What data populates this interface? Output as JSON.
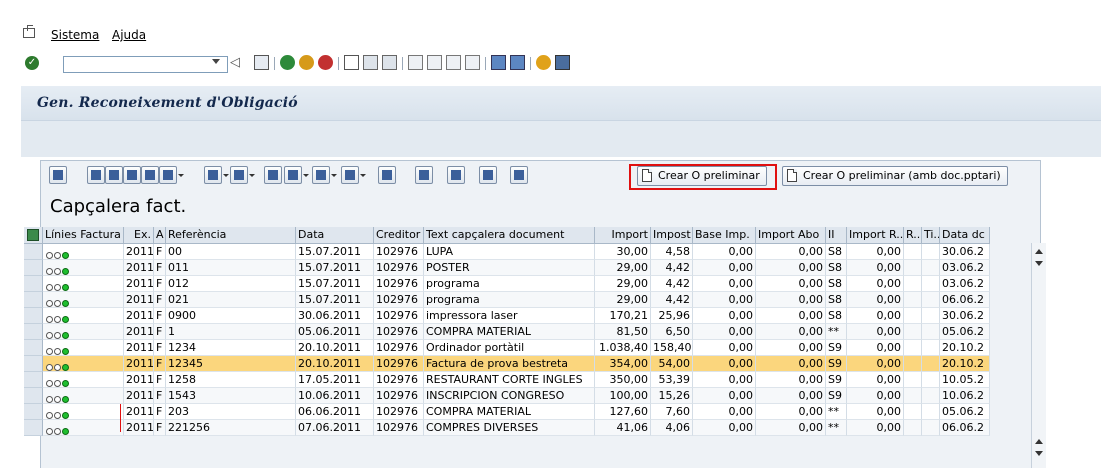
{
  "menu": {
    "items": [
      "Sistema",
      "Ajuda"
    ]
  },
  "toolbar": {
    "command_value": ""
  },
  "title": "Gen. Reconeixement d'Obligació",
  "alv": {
    "button_create": "Crear O preliminar",
    "button_create_pptari": "Crear O preliminar (amb doc.pptari)",
    "grid_title": "Capçalera fact."
  },
  "columns": [
    "Línies Factura",
    "Ex.",
    "A",
    "Referència",
    "Data",
    "Creditor",
    "Text capçalera document",
    "Import",
    "Impost",
    "Base Imp.",
    "Import Abo",
    "II",
    "Import R...",
    "R..",
    "Ti..",
    "Data dc"
  ],
  "rows": [
    {
      "ex": "2011",
      "a": "F",
      "ref": "00",
      "data": "15.07.2011",
      "cred": "102976",
      "text": "LUPA",
      "imp": "30,00",
      "impost": "4,58",
      "base": "0,00",
      "abo": "0,00",
      "ii": "S8",
      "impr": "0,00",
      "r": "",
      "ti": "",
      "datadc": "30.06.2"
    },
    {
      "ex": "2011",
      "a": "F",
      "ref": "011",
      "data": "15.07.2011",
      "cred": "102976",
      "text": "POSTER",
      "imp": "29,00",
      "impost": "4,42",
      "base": "0,00",
      "abo": "0,00",
      "ii": "S8",
      "impr": "0,00",
      "r": "",
      "ti": "",
      "datadc": "03.06.2"
    },
    {
      "ex": "2011",
      "a": "F",
      "ref": "012",
      "data": "15.07.2011",
      "cred": "102976",
      "text": "programa",
      "imp": "29,00",
      "impost": "4,42",
      "base": "0,00",
      "abo": "0,00",
      "ii": "S8",
      "impr": "0,00",
      "r": "",
      "ti": "",
      "datadc": "03.06.2"
    },
    {
      "ex": "2011",
      "a": "F",
      "ref": "021",
      "data": "15.07.2011",
      "cred": "102976",
      "text": "programa",
      "imp": "29,00",
      "impost": "4,42",
      "base": "0,00",
      "abo": "0,00",
      "ii": "S8",
      "impr": "0,00",
      "r": "",
      "ti": "",
      "datadc": "06.06.2"
    },
    {
      "ex": "2011",
      "a": "F",
      "ref": "0900",
      "data": "30.06.2011",
      "cred": "102976",
      "text": "impressora laser",
      "imp": "170,21",
      "impost": "25,96",
      "base": "0,00",
      "abo": "0,00",
      "ii": "S8",
      "impr": "0,00",
      "r": "",
      "ti": "",
      "datadc": "30.06.2"
    },
    {
      "ex": "2011",
      "a": "F",
      "ref": "1",
      "data": "05.06.2011",
      "cred": "102976",
      "text": "COMPRA MATERIAL",
      "imp": "81,50",
      "impost": "6,50",
      "base": "0,00",
      "abo": "0,00",
      "ii": "**",
      "impr": "0,00",
      "r": "",
      "ti": "",
      "datadc": "05.06.2"
    },
    {
      "ex": "2011",
      "a": "F",
      "ref": "1234",
      "data": "20.10.2011",
      "cred": "102976",
      "text": "Ordinador portàtil",
      "imp": "1.038,40",
      "impost": "158,40",
      "base": "0,00",
      "abo": "0,00",
      "ii": "S9",
      "impr": "0,00",
      "r": "",
      "ti": "",
      "datadc": "20.10.2"
    },
    {
      "ex": "2011",
      "a": "F",
      "ref": "12345",
      "data": "20.10.2011",
      "cred": "102976",
      "text": "Factura de prova bestreta",
      "imp": "354,00",
      "impost": "54,00",
      "base": "0,00",
      "abo": "0,00",
      "ii": "S9",
      "impr": "0,00",
      "r": "",
      "ti": "",
      "datadc": "20.10.2",
      "selected": true
    },
    {
      "ex": "2011",
      "a": "F",
      "ref": "1258",
      "data": "17.05.2011",
      "cred": "102976",
      "text": "RESTAURANT CORTE INGLES",
      "imp": "350,00",
      "impost": "53,39",
      "base": "0,00",
      "abo": "0,00",
      "ii": "S9",
      "impr": "0,00",
      "r": "",
      "ti": "",
      "datadc": "10.05.2"
    },
    {
      "ex": "2011",
      "a": "F",
      "ref": "1543",
      "data": "10.06.2011",
      "cred": "102976",
      "text": "INSCRIPCION CONGRESO",
      "imp": "100,00",
      "impost": "15,26",
      "base": "0,00",
      "abo": "0,00",
      "ii": "S9",
      "impr": "0,00",
      "r": "",
      "ti": "",
      "datadc": "10.06.2"
    },
    {
      "ex": "2011",
      "a": "F",
      "ref": "203",
      "data": "06.06.2011",
      "cred": "102976",
      "text": "COMPRA MATERIAL",
      "imp": "127,60",
      "impost": "7,60",
      "base": "0,00",
      "abo": "0,00",
      "ii": "**",
      "impr": "0,00",
      "r": "",
      "ti": "",
      "datadc": "05.06.2"
    },
    {
      "ex": "2011",
      "a": "F",
      "ref": "221256",
      "data": "07.06.2011",
      "cred": "102976",
      "text": "COMPRES DIVERSES",
      "imp": "41,06",
      "impost": "4,06",
      "base": "0,00",
      "abo": "0,00",
      "ii": "**",
      "impr": "0,00",
      "r": "",
      "ti": "",
      "datadc": "06.06.2"
    }
  ],
  "colors": {
    "selected_row": "#fbd67d",
    "highlight": "#e01010",
    "title": "#13284c",
    "light_on": "#1fbf2f"
  }
}
